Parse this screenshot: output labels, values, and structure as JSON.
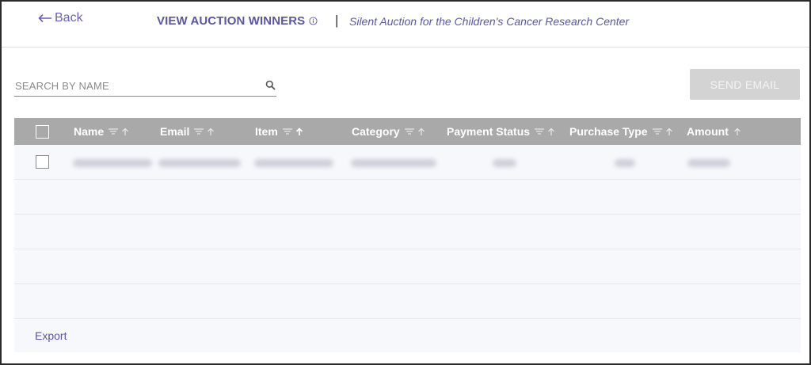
{
  "header": {
    "back_label": "Back",
    "title": "VIEW AUCTION WINNERS",
    "separator": "|",
    "subtitle": "Silent Auction for the Children's Cancer Research Center"
  },
  "search": {
    "placeholder": "SEARCH BY NAME",
    "value": ""
  },
  "actions": {
    "send_email_label": "SEND EMAIL"
  },
  "table": {
    "columns": [
      {
        "label": "Name"
      },
      {
        "label": "Email"
      },
      {
        "label": "Item"
      },
      {
        "label": "Category"
      },
      {
        "label": "Payment Status"
      },
      {
        "label": "Purchase Type"
      },
      {
        "label": "Amount"
      }
    ]
  },
  "footer": {
    "export_label": "Export"
  },
  "colors": {
    "accent": "#5b55a8",
    "header_bg": "#a9a9a9",
    "button_disabled": "#d3d3d3",
    "row_bg": "#f7f8fc"
  }
}
